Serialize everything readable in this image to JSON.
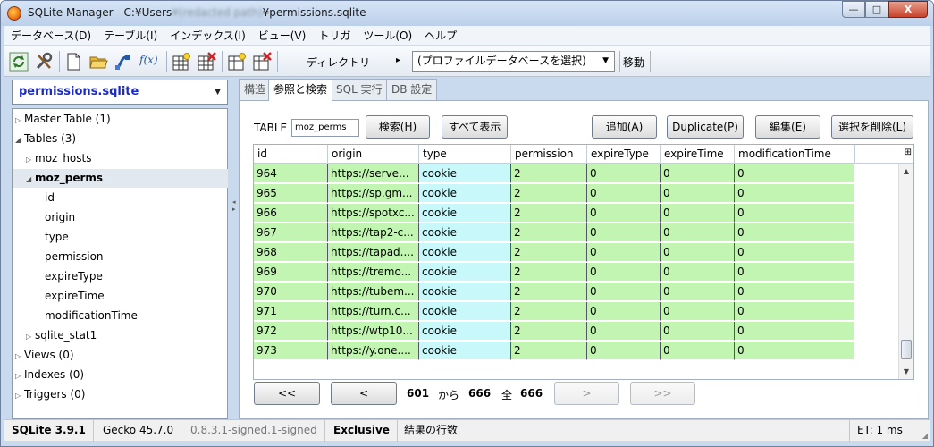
{
  "window": {
    "title_prefix": "SQLite Manager - C:¥Users",
    "title_blurred": "¥(redacted path)",
    "title_suffix": "¥permissions.sqlite",
    "min_label": "—",
    "max_label": "□",
    "close_label": "X"
  },
  "menu": [
    "データベース(D)",
    "テーブル(I)",
    "インデックス(I)",
    "ビュー(V)",
    "トリガ",
    "ツール(O)",
    "ヘルプ"
  ],
  "toolbar": {
    "fx_label": "f(x)",
    "directory_label": "ディレクトリ",
    "directory_arrow": "▸",
    "profile_dropdown": "(プロファイルデータベースを選択)",
    "go_label": "移動"
  },
  "sidebar": {
    "db_name": "permissions.sqlite",
    "tree": {
      "master": "Master Table (1)",
      "tables": "Tables (3)",
      "moz_hosts": "moz_hosts",
      "moz_perms": "moz_perms",
      "columns": [
        "id",
        "origin",
        "type",
        "permission",
        "expireType",
        "expireTime",
        "modificationTime"
      ],
      "sqlite_stat1": "sqlite_stat1",
      "views": "Views (0)",
      "indexes": "Indexes (0)",
      "triggers": "Triggers (0)"
    }
  },
  "tabs": [
    "構造",
    "参照と検索",
    "SQL 実行",
    "DB 設定"
  ],
  "browse": {
    "table_label": "TABLE",
    "table_value": "moz_perms",
    "search_button": "検索(H)",
    "show_all_button": "すべて表示",
    "add_button": "追加(A)",
    "duplicate_button": "Duplicate(P)",
    "edit_button": "編集(E)",
    "delete_button": "選択を削除(L)"
  },
  "grid": {
    "columns": [
      "id",
      "origin",
      "type",
      "permission",
      "expireType",
      "expireTime",
      "modificationTime"
    ],
    "rows": [
      [
        "964",
        "https://serve...",
        "cookie",
        "2",
        "0",
        "0",
        "0"
      ],
      [
        "965",
        "https://sp.gm...",
        "cookie",
        "2",
        "0",
        "0",
        "0"
      ],
      [
        "966",
        "https://spotxc...",
        "cookie",
        "2",
        "0",
        "0",
        "0"
      ],
      [
        "967",
        "https://tap2-c...",
        "cookie",
        "2",
        "0",
        "0",
        "0"
      ],
      [
        "968",
        "https://tapad....",
        "cookie",
        "2",
        "0",
        "0",
        "0"
      ],
      [
        "969",
        "https://tremo...",
        "cookie",
        "2",
        "0",
        "0",
        "0"
      ],
      [
        "970",
        "https://tubem...",
        "cookie",
        "2",
        "0",
        "0",
        "0"
      ],
      [
        "971",
        "https://turn.c...",
        "cookie",
        "2",
        "0",
        "0",
        "0"
      ],
      [
        "972",
        "https://wtp10...",
        "cookie",
        "2",
        "0",
        "0",
        "0"
      ],
      [
        "973",
        "https://y.one....",
        "cookie",
        "2",
        "0",
        "0",
        "0"
      ]
    ]
  },
  "pager": {
    "first": "<<",
    "prev": "<",
    "from": "601",
    "from_label": "から",
    "to": "666",
    "of_label": "全",
    "total": "666",
    "next": ">",
    "last": ">>"
  },
  "status": {
    "sqlite_version": "SQLite 3.9.1",
    "gecko": "Gecko 45.7.0",
    "ext_version": "0.8.3.1-signed.1-signed",
    "lock_mode": "Exclusive",
    "result_label": "結果の行数",
    "elapsed": "ET: 1 ms"
  },
  "colors": {
    "row_green": "#c2f5b1",
    "row_cyan": "#c9f8fb",
    "db_name_blue": "#1b2bc2"
  }
}
